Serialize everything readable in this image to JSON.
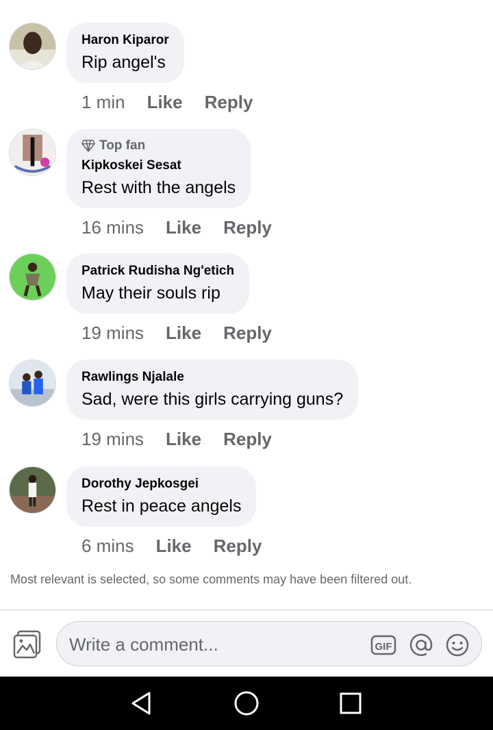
{
  "comments": [
    {
      "author": "Haron Kiparor",
      "text": "Rip angel's",
      "time": "1 min",
      "like": "Like",
      "reply": "Reply",
      "badge": ""
    },
    {
      "author": "Kipkoskei Sesat",
      "text": "Rest with the angels",
      "time": "16 mins",
      "like": "Like",
      "reply": "Reply",
      "badge": "Top fan"
    },
    {
      "author": "Patrick Rudisha Ng'etich",
      "text": "May their souls rip",
      "time": "19 mins",
      "like": "Like",
      "reply": "Reply",
      "badge": ""
    },
    {
      "author": "Rawlings Njalale",
      "text": "Sad, were this girls carrying guns?",
      "time": "19 mins",
      "like": "Like",
      "reply": "Reply",
      "badge": ""
    },
    {
      "author": "Dorothy Jepkosgei",
      "text": "Rest in peace angels",
      "time": "6 mins",
      "like": "Like",
      "reply": "Reply",
      "badge": ""
    }
  ],
  "notice": "Most relevant is selected, so some comments may have been filtered out.",
  "composer": {
    "placeholder": "Write a comment..."
  },
  "icons": {
    "photo": "photo-icon",
    "gif": "gif-icon",
    "mention": "at-sign-icon",
    "emoji": "smiley-icon",
    "topfan": "diamond-icon",
    "back": "back-triangle-icon",
    "home": "home-circle-icon",
    "recents": "recents-square-icon"
  },
  "colors": {
    "bubble": "#f0f2f5",
    "secondary_text": "#65676b",
    "primary_text": "#050505",
    "nav_bar": "#000000"
  }
}
